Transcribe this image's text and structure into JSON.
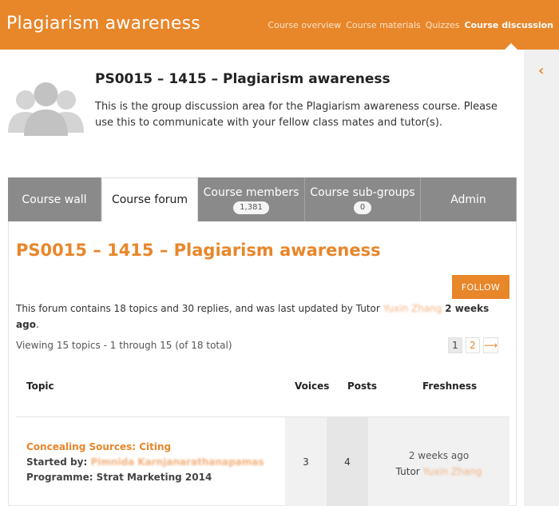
{
  "header": {
    "site_title": "Plagiarism awareness",
    "nav": [
      {
        "label": "Course overview",
        "active": false
      },
      {
        "label": "Course materials",
        "active": false
      },
      {
        "label": "Quizzes",
        "active": false
      },
      {
        "label": "Course discussion",
        "active": true
      }
    ]
  },
  "sidebar": {
    "toggle_icon": "chevron-left-icon"
  },
  "group": {
    "avatar_icon": "group-avatar-icon",
    "title": "PS0015 – 1415 – Plagiarism awareness",
    "description": "This is the group discussion area for the Plagiarism awareness course. Please use this to communicate with your fellow class mates and tutor(s)."
  },
  "tabs": [
    {
      "label": "Course wall",
      "badge": null,
      "active": false
    },
    {
      "label": "Course forum",
      "badge": null,
      "active": true
    },
    {
      "label": "Course members",
      "badge": "1,381",
      "active": false
    },
    {
      "label": "Course sub-groups",
      "badge": "0",
      "active": false
    },
    {
      "label": "Admin",
      "badge": null,
      "active": false
    }
  ],
  "forum": {
    "title": "PS0015 – 1415 – Plagiarism awareness",
    "follow_label": "FOLLOW",
    "info_prefix": "This forum contains 18 topics and 30 replies, and was last updated by Tutor ",
    "info_user": "Yuxin Zhang",
    "info_time": "2 weeks ago",
    "info_suffix": ".",
    "viewing": "Viewing 15 topics - 1 through 15 (of 18 total)",
    "pagination": {
      "current": "1",
      "next_page": "2",
      "next_icon": "arrow-right-icon",
      "next_symbol": "⟶"
    },
    "columns": {
      "topic": "Topic",
      "voices": "Voices",
      "posts": "Posts",
      "freshness": "Freshness"
    },
    "topics": [
      {
        "title": "Concealing Sources: Citing",
        "started_by_label": "Started by:",
        "started_by": "Pimnida Karnjanarathanapamas",
        "programme": "Programme: Strat Marketing 2014",
        "voices": "3",
        "posts": "4",
        "freshness": "2 weeks ago",
        "last_by_prefix": "Tutor",
        "last_by": "Yuxin Zhang"
      }
    ]
  },
  "colors": {
    "accent": "#e8862a",
    "tab_inactive": "#8a8a8a",
    "sidebar_bg": "#f0f0f0"
  }
}
